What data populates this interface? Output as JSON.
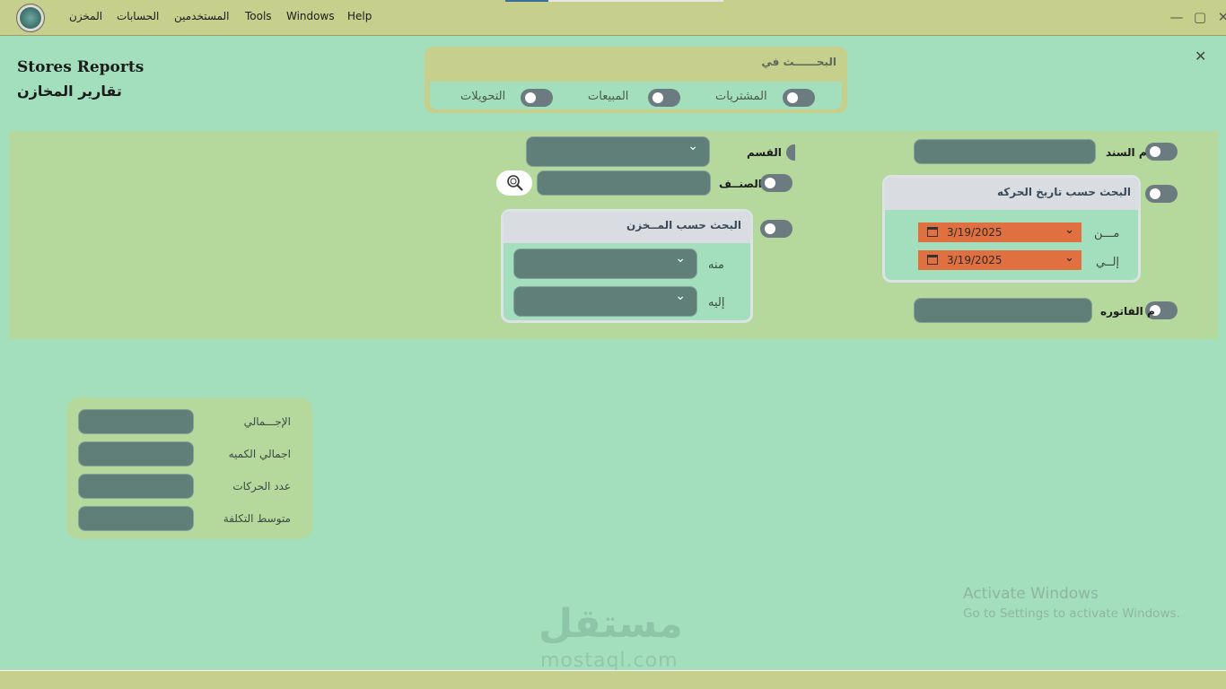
{
  "menu": {
    "items": [
      "المخزن",
      "الحسابات",
      "المستخدمين",
      "Tools",
      "Windows",
      "Help"
    ],
    "minimize": "—",
    "maximize": "▢",
    "close": "✕"
  },
  "page": {
    "title_en": "Stores Reports",
    "title_ar": "تقارير المخازن",
    "close_glyph": "✕"
  },
  "search_in": {
    "title": "البحــــــث في",
    "options": [
      "المشتريات",
      "المبيعات",
      "التحويلات"
    ]
  },
  "filters": {
    "doc_number_label": "م السند",
    "invoice_number_label": "م الفاتوره",
    "department_label": "القسم",
    "item_label": "الصنــف",
    "date_group": {
      "title": "البحث حسب تاريخ الحركه",
      "from_label": "مـــن",
      "to_label": "إلــي",
      "from_value": "3/19/2025",
      "to_value": "3/19/2025"
    },
    "store_group": {
      "title": "البحث حسب المــخزن",
      "from_label": "منه",
      "to_label": "إليه"
    }
  },
  "totals": {
    "labels": [
      "الإجـــمالي",
      "اجمالي الكميه",
      "عدد الحركات",
      "متوسط التكلفة"
    ]
  },
  "watermark": {
    "activate_title": "Activate Windows",
    "activate_sub": "Go to Settings to activate Windows.",
    "site_ar": "مستقل",
    "site_en": "mostaql.com"
  }
}
